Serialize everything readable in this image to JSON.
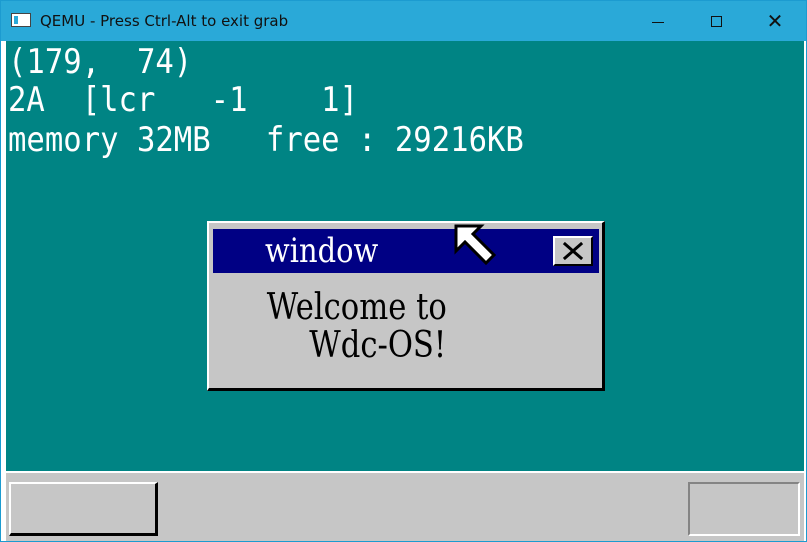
{
  "window": {
    "title": "QEMU - Press Ctrl-Alt to exit grab",
    "icons": {
      "app": "qemu-app-icon",
      "minimize": "minimize-icon",
      "maximize": "maximize-icon",
      "close": "close-icon"
    },
    "close_glyph": "✕"
  },
  "screen": {
    "background_color": "#008484",
    "text_color": "#ffffff",
    "lines": {
      "mouse_coords": "(179,  74)",
      "key_info": "2A  [lcr   -1    1]",
      "memory": "memory 32MB   free : 29216KB"
    }
  },
  "os_window": {
    "title": "window",
    "title_bar_color": "#000084",
    "close_icon": "close-x-icon",
    "message": {
      "line1": "Welcome to",
      "line2": "Wdc-OS!"
    }
  },
  "cursor": {
    "icon": "mouse-pointer-icon"
  },
  "taskbar": {
    "color": "#c6c6c6",
    "start_button_label": "",
    "tray_label": ""
  }
}
